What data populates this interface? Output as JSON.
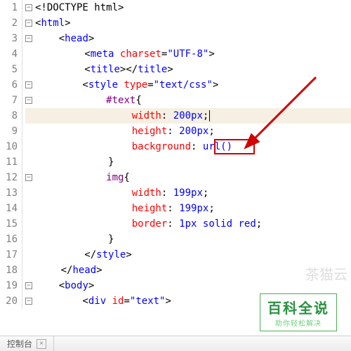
{
  "lines": [
    {
      "n": 1,
      "fold": true
    },
    {
      "n": 2,
      "fold": true
    },
    {
      "n": 3,
      "fold": true
    },
    {
      "n": 4
    },
    {
      "n": 5
    },
    {
      "n": 6,
      "fold": true
    },
    {
      "n": 7,
      "fold": true
    },
    {
      "n": 8,
      "highlight": true
    },
    {
      "n": 9
    },
    {
      "n": 10
    },
    {
      "n": 11
    },
    {
      "n": 12,
      "fold": true
    },
    {
      "n": 13
    },
    {
      "n": 14
    },
    {
      "n": 15
    },
    {
      "n": 16
    },
    {
      "n": 17
    },
    {
      "n": 18
    },
    {
      "n": 19,
      "fold": true
    },
    {
      "n": 20,
      "fold": true
    }
  ],
  "code": {
    "doctype": "<!DOCTYPE html>",
    "html_open": "html",
    "head_open": "head",
    "meta_tag": "meta",
    "meta_attr_charset": "charset",
    "meta_val_charset": "\"UTF-8\"",
    "title_tag": "title",
    "style_tag": "style",
    "style_attr_type": "type",
    "style_val_type": "\"text/css\"",
    "sel_text": "#text",
    "brace_open": "{",
    "brace_close": "}",
    "prop_width": "width",
    "prop_height": "height",
    "prop_background": "background",
    "prop_border": "border",
    "val_200px": "200px",
    "val_199px": "199px",
    "val_url": "url()",
    "val_border": "1px solid red",
    "sel_img": "img",
    "body_tag": "body",
    "div_tag": "div",
    "div_attr_id": "id",
    "div_val_id": "\"text\"",
    "semicolon": ";",
    "colon": ":",
    "lt": "<",
    "gt": ">",
    "slash": "/",
    "eq": "=",
    "sp1": "    ",
    "sp2": "        ",
    "sp3": "            ",
    "sp4": "                "
  },
  "watermark": "茶猫云",
  "badge": {
    "title": "百科全说",
    "sub": "助你轻松解决"
  },
  "bottombar": {
    "tab1": "控制台"
  }
}
